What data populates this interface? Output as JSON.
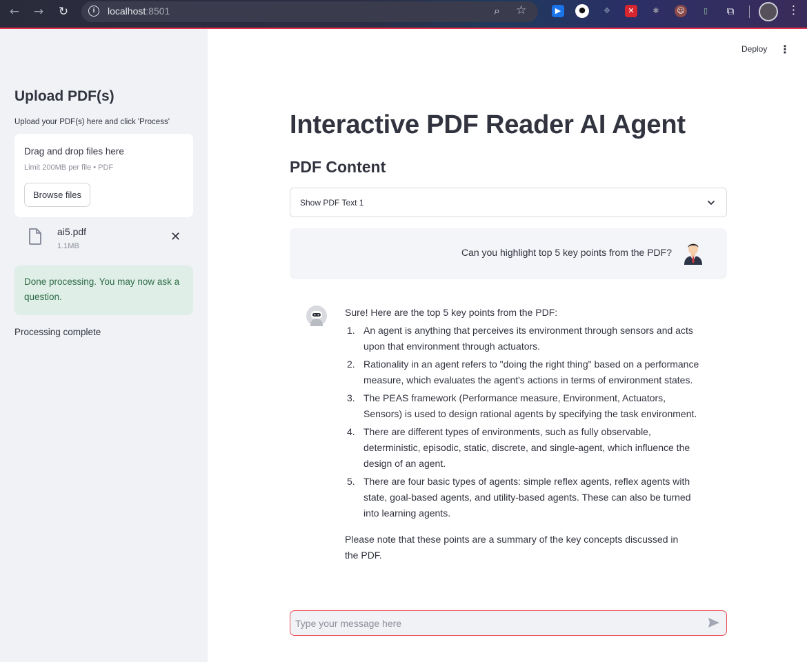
{
  "browser": {
    "url_host": "localhost",
    "url_port": ":8501"
  },
  "sidebar": {
    "title": "Upload PDF(s)",
    "description": "Upload your PDF(s) here and click 'Process'",
    "dropzone": {
      "title": "Drag and drop files here",
      "limit": "Limit 200MB per file • PDF",
      "browse_label": "Browse files"
    },
    "file": {
      "name": "ai5.pdf",
      "size": "1.1MB"
    },
    "success_message": "Done processing. You may now ask a question.",
    "status": "Processing complete"
  },
  "header": {
    "deploy_label": "Deploy"
  },
  "main": {
    "title": "Interactive PDF Reader AI Agent",
    "section_title": "PDF Content",
    "expander_label": "Show PDF Text 1",
    "user_message": "Can you highlight top 5 key points from the PDF?",
    "bot_intro": "Sure! Here are the top 5 key points from the PDF:",
    "bot_points": [
      {
        "num": "1.",
        "text": "An agent is anything that perceives its environment through sensors and acts upon that environment through actuators."
      },
      {
        "num": "2.",
        "text": "Rationality in an agent refers to \"doing the right thing\" based on a performance measure, which evaluates the agent's actions in terms of environment states."
      },
      {
        "num": "3.",
        "text": "The PEAS framework (Performance measure, Environment, Actuators, Sensors) is used to design rational agents by specifying the task environment."
      },
      {
        "num": "4.",
        "text": "There are different types of environments, such as fully observable, deterministic, episodic, static, discrete, and single-agent, which influence the design of an agent."
      },
      {
        "num": "5.",
        "text": "There are four basic types of agents: simple reflex agents, reflex agents with state, goal-based agents, and utility-based agents. These can also be turned into learning agents."
      }
    ],
    "bot_outro": "Please note that these points are a summary of the key concepts discussed in the PDF.",
    "chat_placeholder": "Type your message here"
  },
  "colors": {
    "sidebar_bg": "#f0f2f6",
    "success_bg": "#dfeee7",
    "success_text": "#2e6b46",
    "input_focus_border": "#ea4a54"
  }
}
